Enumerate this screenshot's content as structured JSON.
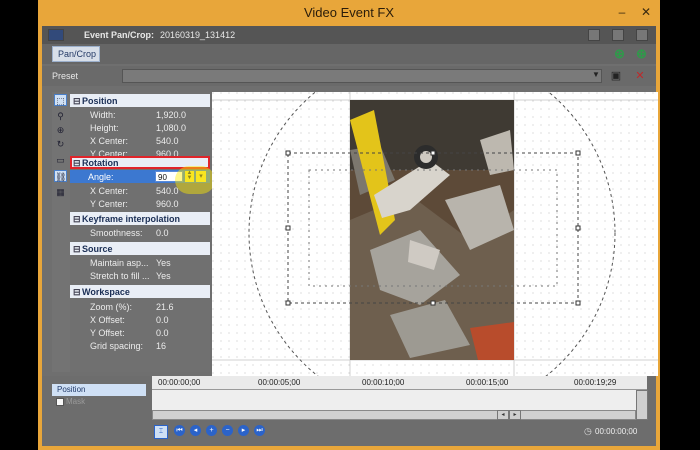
{
  "window": {
    "title": "Video Event FX",
    "controls": [
      "minimize",
      "maximize",
      "close"
    ]
  },
  "header": {
    "label": "Event Pan/Crop:",
    "value": "20160319_131412"
  },
  "fx_chain": {
    "tab_label": "Pan/Crop"
  },
  "preset": {
    "label": "Preset",
    "value": ""
  },
  "sections": [
    {
      "name": "Position",
      "rows": [
        {
          "key": "Width:",
          "value": "1,920.0"
        },
        {
          "key": "Height:",
          "value": "1,080.0"
        },
        {
          "key": "X Center:",
          "value": "540.0"
        },
        {
          "key": "Y Center:",
          "value": "960.0"
        }
      ]
    },
    {
      "name": "Rotation",
      "rows": [
        {
          "key": "Angle:",
          "value": "90"
        },
        {
          "key": "X Center:",
          "value": "540.0"
        },
        {
          "key": "Y Center:",
          "value": "960.0"
        }
      ]
    },
    {
      "name": "Keyframe interpolation",
      "rows": [
        {
          "key": "Smoothness:",
          "value": "0.0"
        }
      ]
    },
    {
      "name": "Source",
      "rows": [
        {
          "key": "Maintain asp...",
          "value": "Yes"
        },
        {
          "key": "Stretch to fill ...",
          "value": "Yes"
        }
      ]
    },
    {
      "name": "Workspace",
      "rows": [
        {
          "key": "Zoom (%):",
          "value": "21.6"
        },
        {
          "key": "X Offset:",
          "value": "0.0"
        },
        {
          "key": "Y Offset:",
          "value": "0.0"
        },
        {
          "key": "Grid spacing:",
          "value": "16"
        }
      ]
    }
  ],
  "timeline": {
    "tracks": [
      "Position",
      "Mask"
    ],
    "ruler": [
      "00:00:00;00",
      "00:00:05;00",
      "00:00:10;00",
      "00:00:15;00",
      "00:00:19;29"
    ],
    "end_time": "00:00:00;00"
  },
  "colors": {
    "title_bar": "#e8a63a",
    "panel": "#707070",
    "selection": "#3c78d0",
    "highlight_outline": "#e0242a"
  }
}
